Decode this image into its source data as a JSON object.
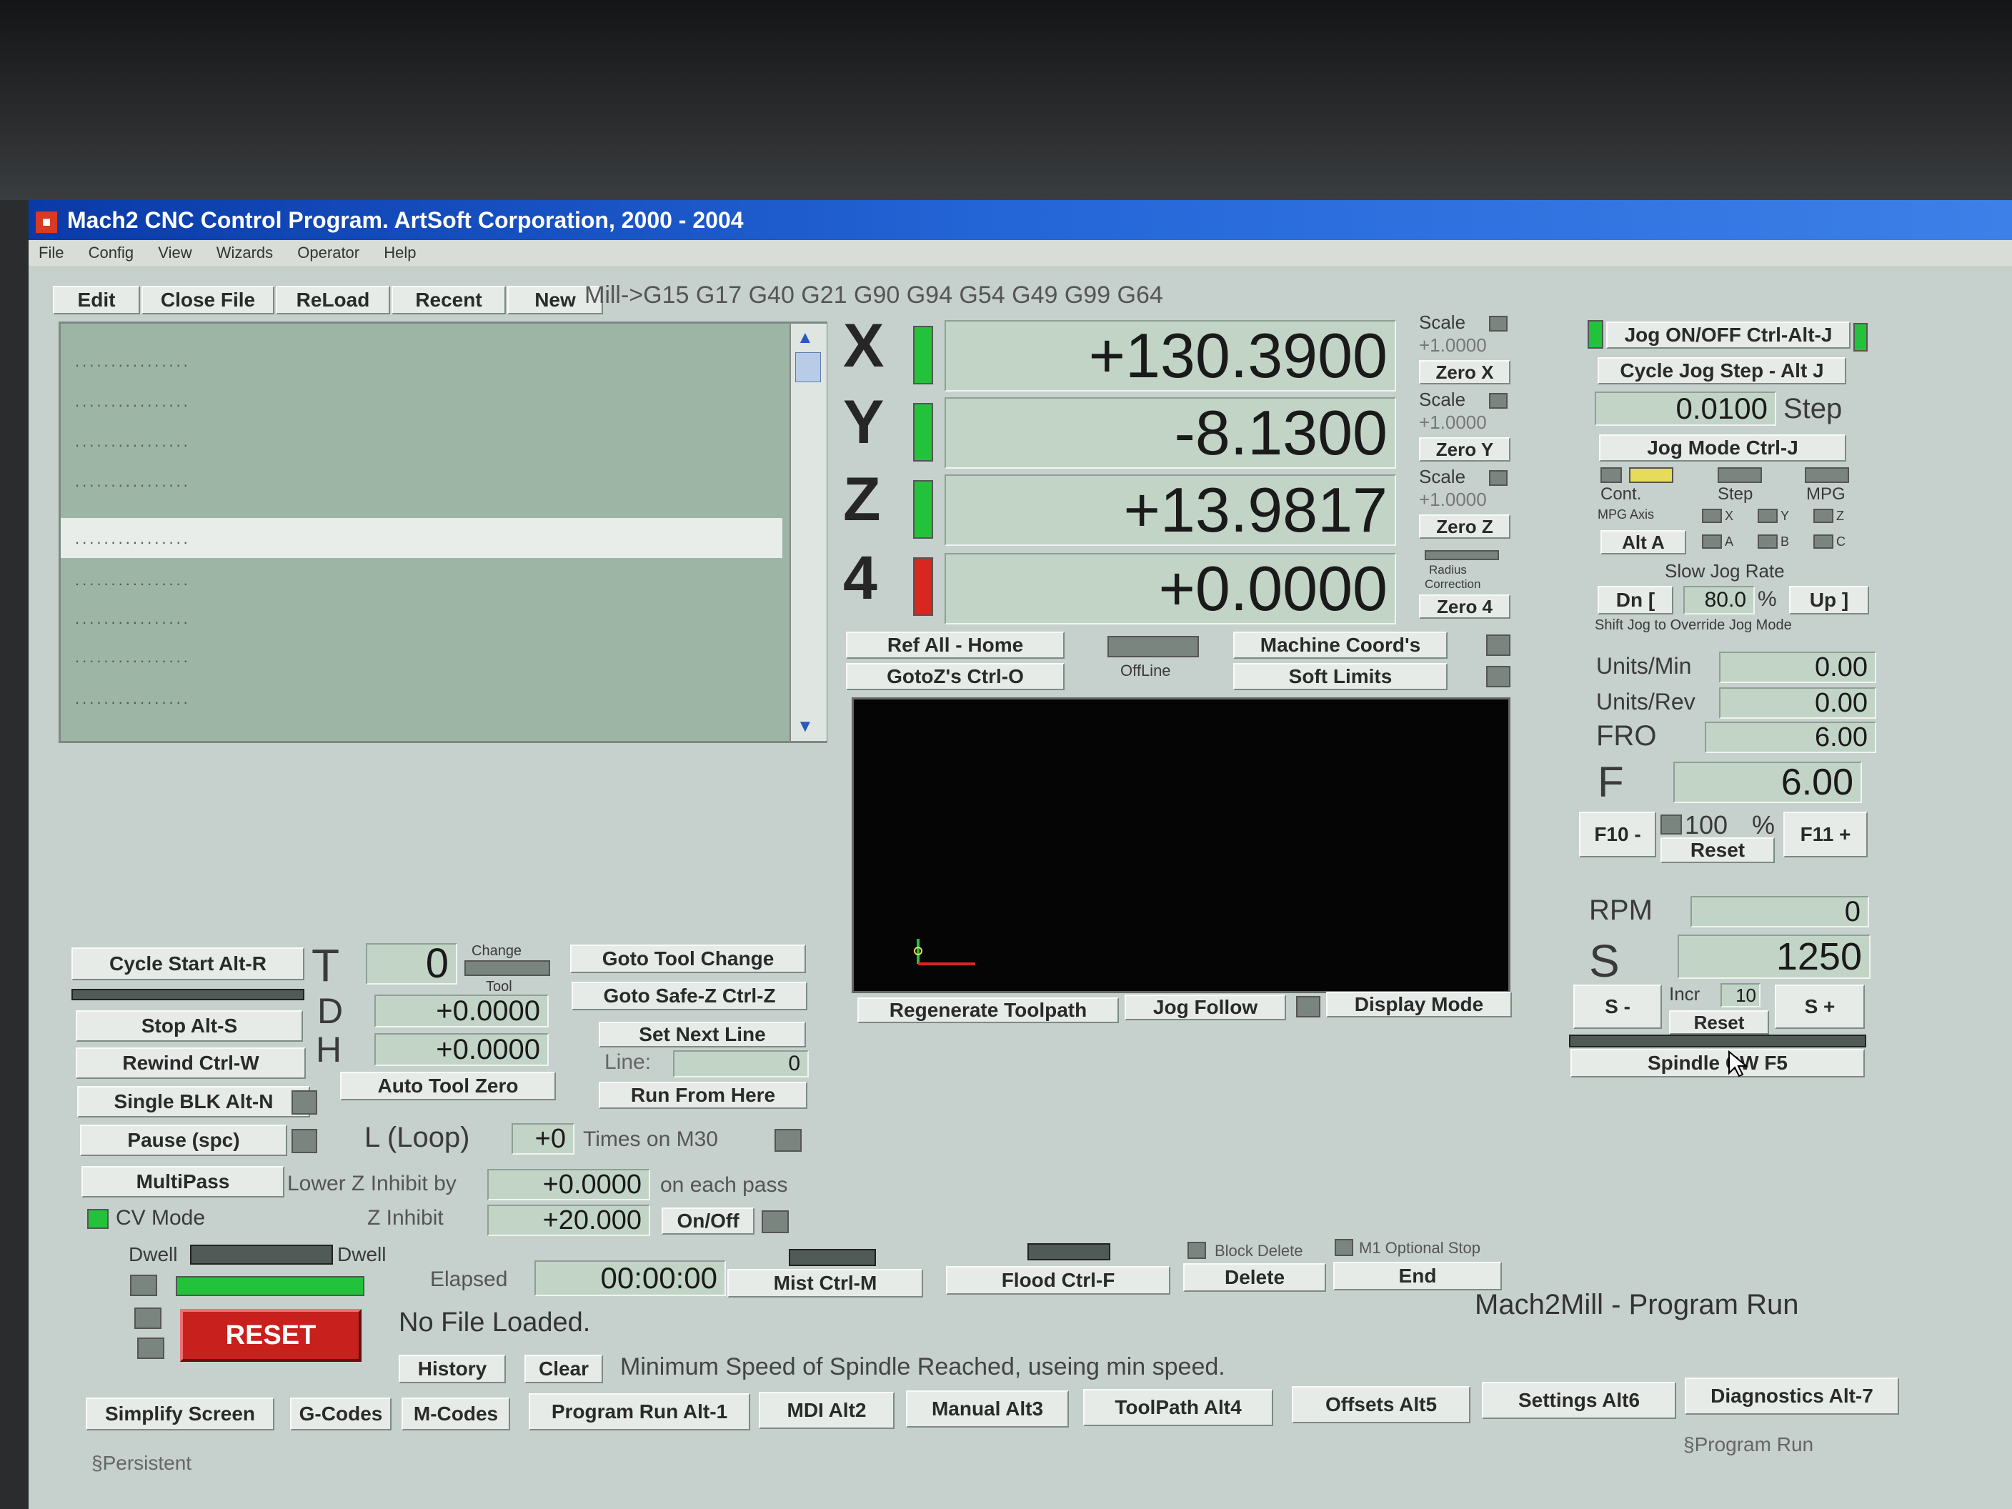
{
  "window": {
    "title": "Mach2 CNC Control Program. ArtSoft Corporation, 2000 - 2004"
  },
  "menu": [
    "File",
    "Config",
    "View",
    "Wizards",
    "Operator",
    "Help"
  ],
  "file_toolbar": {
    "edit": "Edit",
    "close_file": "Close File",
    "reload": "ReLoad",
    "recent": "Recent",
    "new": "New"
  },
  "modal_codes": "Mill->G15  G17 G40 G21 G90 G94 G54 G49 G99 G64",
  "gcode_lines": [
    "................",
    "................",
    "................",
    "................",
    "................",
    "................",
    "................",
    "................",
    "................",
    "................"
  ],
  "axes": [
    {
      "name": "X",
      "value": "+130.3900",
      "status": "green",
      "zero": "Zero X",
      "scale_label": "Scale",
      "scale_value": "+1.0000"
    },
    {
      "name": "Y",
      "value": "-8.1300",
      "status": "green",
      "zero": "Zero Y",
      "scale_label": "Scale",
      "scale_value": "+1.0000"
    },
    {
      "name": "Z",
      "value": "+13.9817",
      "status": "green",
      "zero": "Zero Z",
      "scale_label": "Scale",
      "scale_value": "+1.0000"
    },
    {
      "name": "4",
      "value": "+0.0000",
      "status": "red",
      "zero": "Zero 4",
      "radius_line1": "Radius",
      "radius_line2": "Correction"
    }
  ],
  "position_buttons": {
    "ref_all": "Ref All - Home",
    "goto_zs": "GotoZ's Ctrl-O",
    "offline": "OffLine",
    "machine_coords": "Machine Coord's",
    "soft_limits": "Soft Limits"
  },
  "jog": {
    "jog_on_off": "Jog ON/OFF Ctrl-Alt-J",
    "cycle_jog_step": "Cycle Jog Step - Alt J",
    "step_value": "0.0100",
    "step_label": "Step",
    "jog_mode": "Jog Mode Ctrl-J",
    "cont": "Cont.",
    "step": "Step",
    "mpg": "MPG",
    "mpg_axis": "MPG Axis",
    "x": "X",
    "y": "Y",
    "z": "Z",
    "a": "A",
    "b": "B",
    "c": "C",
    "alt_a": "Alt A",
    "slow_jog_rate": "Slow Jog Rate",
    "dn": "Dn [",
    "rate": "80.0",
    "percent": "%",
    "up": "Up ]",
    "shift_note": "Shift Jog to Override Jog Mode"
  },
  "feed": {
    "units_min_label": "Units/Min",
    "units_min": "0.00",
    "units_rev_label": "Units/Rev",
    "units_rev": "0.00",
    "fro_label": "FRO",
    "fro": "6.00",
    "f_label": "F",
    "f_value": "6.00",
    "f10": "F10 -",
    "f11": "F11 +",
    "pct": "100",
    "pct_sign": "%",
    "reset": "Reset"
  },
  "spindle": {
    "rpm_label": "RPM",
    "rpm": "0",
    "s_label": "S",
    "s_value": "1250",
    "s_minus": "S -",
    "s_plus": "S +",
    "incr_label": "Incr",
    "incr": "10",
    "reset": "Reset",
    "spindle_btn": "Spindle CW F5"
  },
  "left_controls": {
    "cycle_start": "Cycle Start Alt-R",
    "stop": "Stop Alt-S",
    "rewind": "Rewind Ctrl-W",
    "single_blk": "Single BLK Alt-N",
    "pause": "Pause (spc)",
    "multipass": "MultiPass",
    "cv_mode": "CV Mode",
    "dwell": "Dwell"
  },
  "tool": {
    "t_label": "T",
    "t_value": "0",
    "change": "Change",
    "tool_word": "Tool",
    "d_label": "D",
    "d_value": "+0.0000",
    "h_label": "H",
    "h_value": "+0.0000",
    "auto_tool_zero": "Auto Tool Zero",
    "goto_tool_change": "Goto Tool Change",
    "goto_safe_z": "Goto Safe-Z Ctrl-Z",
    "set_next_line": "Set Next Line",
    "line_label": "Line:",
    "line_value": "0",
    "run_from_here": "Run From Here"
  },
  "loop": {
    "label": "L (Loop)",
    "value": "+0",
    "times": "Times on M30",
    "lower_z": "Lower Z Inhibit by",
    "lower_z_value": "+0.0000",
    "each_pass": "on each pass",
    "z_inhibit": "Z Inhibit",
    "z_inhibit_value": "+20.000",
    "on_off": "On/Off"
  },
  "toolpath_buttons": {
    "regenerate": "Regenerate Toolpath",
    "jog_follow": "Jog Follow",
    "display_mode": "Display Mode"
  },
  "lower_controls": {
    "elapsed_label": "Elapsed",
    "elapsed": "00:00:00",
    "mist": "Mist Ctrl-M",
    "flood": "Flood Ctrl-F",
    "block_delete": "Block Delete",
    "m1_stop": "M1 Optional Stop",
    "delete": "Delete",
    "end": "End",
    "reset": "RESET"
  },
  "status": {
    "file": "No File Loaded.",
    "mode": "Mach2Mill  - Program Run",
    "message": "Minimum Speed of Spindle Reached, useing min speed.",
    "history": "History",
    "clear": "Clear"
  },
  "screens": [
    "Simplify Screen",
    "G-Codes",
    "M-Codes",
    "Program Run Alt-1",
    "MDI Alt2",
    "Manual Alt3",
    "ToolPath Alt4",
    "Offsets Alt5",
    "Settings Alt6",
    "Diagnostics Alt-7"
  ],
  "footer": {
    "left": "§Persistent",
    "right": "§Program Run"
  },
  "colors": {
    "background": "#c6d0cc",
    "dro": "#c2d4c6",
    "led_green": "#22c33a",
    "led_red": "#d8271e",
    "title": "#0a3aa8"
  }
}
